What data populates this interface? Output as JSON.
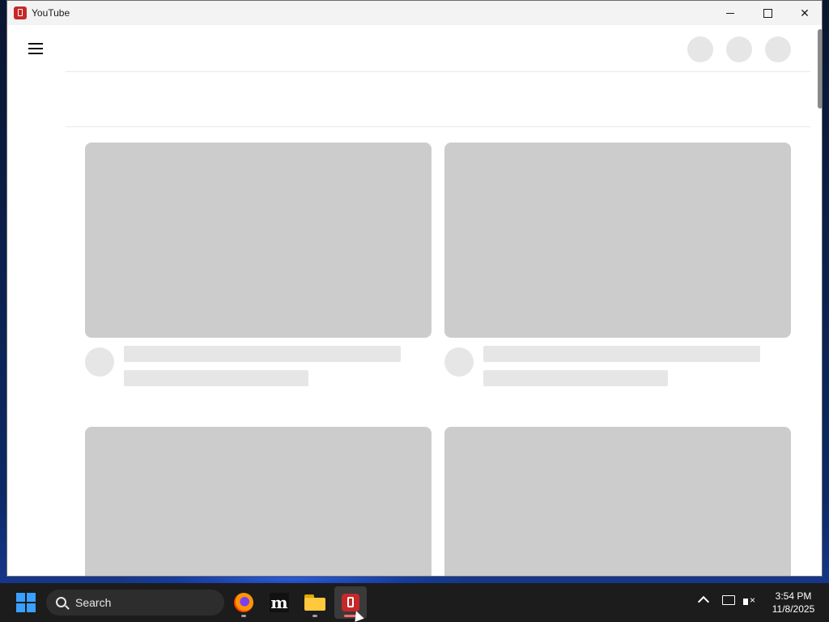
{
  "window": {
    "title": "YouTube",
    "app_icon": "red-tablet-icon"
  },
  "window_controls": {
    "minimize": "minimize-icon",
    "maximize": "maximize-icon",
    "close": "close-icon"
  },
  "page": {
    "state": "loading skeleton",
    "menu_icon": "hamburger-menu-icon"
  },
  "taskbar": {
    "search_label": "Search",
    "apps": [
      "firefox-icon",
      "m-app-icon",
      "file-explorer-icon",
      "red-tablet-app-icon"
    ],
    "time": "3:54 PM",
    "date": "11/8/2025"
  },
  "colors": {
    "skeleton_thumb": "#cccccc",
    "skeleton_line": "#e6e6e6",
    "taskbar": "#1c1c1c",
    "accent_red": "#c62828"
  }
}
